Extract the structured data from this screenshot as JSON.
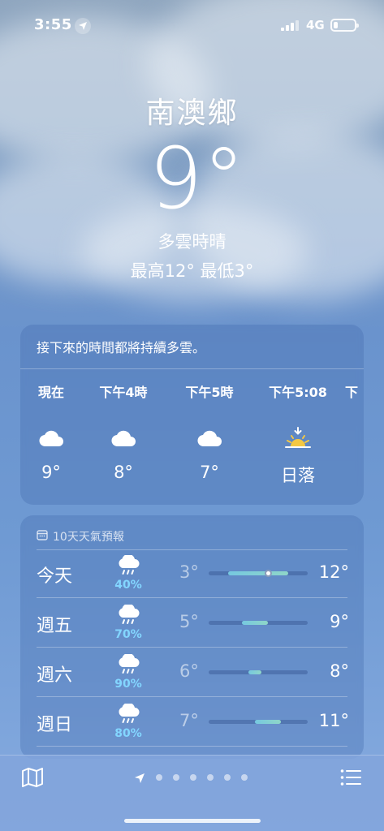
{
  "status_bar": {
    "time": "3:55",
    "network": "4G"
  },
  "location": {
    "city": "南澳鄉",
    "temperature": "9°",
    "condition": "多雲時晴",
    "high_low": "最高12°  最低3°"
  },
  "hourly": {
    "summary": "接下來的時間都將持續多雲。",
    "items": [
      {
        "label": "現在",
        "icon": "cloud-icon",
        "value": "9°"
      },
      {
        "label": "下午4時",
        "icon": "cloud-icon",
        "value": "8°"
      },
      {
        "label": "下午5時",
        "icon": "cloud-icon",
        "value": "7°"
      },
      {
        "label": "下午5:08",
        "icon": "sunset-icon",
        "value": "日落"
      },
      {
        "label": "下",
        "icon": "cloud-icon",
        "value": ""
      }
    ]
  },
  "daily": {
    "title": "10天天氣預報",
    "rows": [
      {
        "day": "今天",
        "icon": "cloud-rain-icon",
        "precip": "40%",
        "low": "3°",
        "high": "12°",
        "range_start": 3,
        "range_end": 12,
        "current": 9
      },
      {
        "day": "週五",
        "icon": "cloud-rain-icon",
        "precip": "70%",
        "low": "5°",
        "high": "9°",
        "range_start": 5,
        "range_end": 9
      },
      {
        "day": "週六",
        "icon": "cloud-rain-icon",
        "precip": "90%",
        "low": "6°",
        "high": "8°",
        "range_start": 6,
        "range_end": 8
      },
      {
        "day": "週日",
        "icon": "cloud-rain-icon",
        "precip": "80%",
        "low": "7°",
        "high": "11°",
        "range_start": 7,
        "range_end": 11
      }
    ],
    "scale_min": 0,
    "scale_max": 15
  },
  "bottom_bar": {
    "pages": 6,
    "active_page": 0
  },
  "colors": {
    "precip": "#83d6ff",
    "bar_fill": "#7fcfd8",
    "sun": "#f5c842"
  }
}
